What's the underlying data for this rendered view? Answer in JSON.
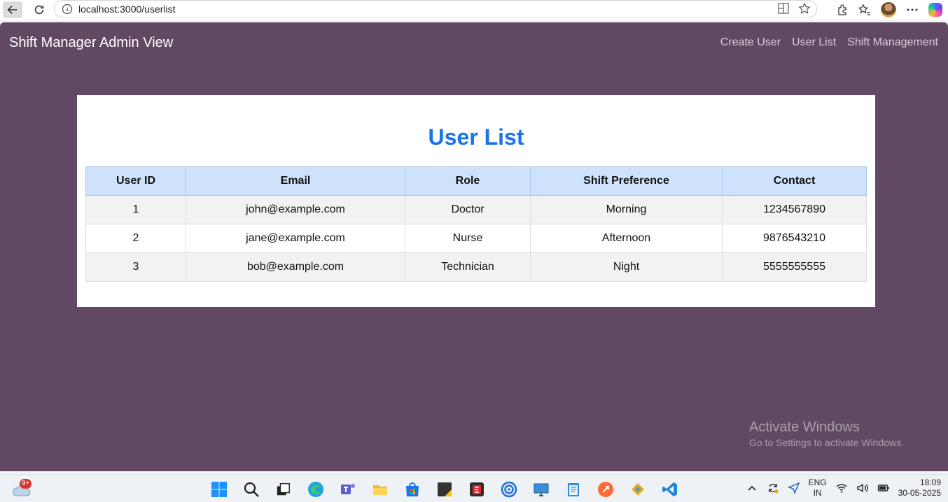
{
  "browser": {
    "url": "localhost:3000/userlist"
  },
  "app": {
    "title": "Shift Manager Admin View",
    "nav": [
      "Create User",
      "User List",
      "Shift Management"
    ]
  },
  "userlist": {
    "title": "User List",
    "columns": [
      "User ID",
      "Email",
      "Role",
      "Shift Preference",
      "Contact"
    ],
    "rows": [
      [
        "1",
        "john@example.com",
        "Doctor",
        "Morning",
        "1234567890"
      ],
      [
        "2",
        "jane@example.com",
        "Nurse",
        "Afternoon",
        "9876543210"
      ],
      [
        "3",
        "bob@example.com",
        "Technician",
        "Night",
        "5555555555"
      ]
    ]
  },
  "watermark": {
    "title": "Activate Windows",
    "subtitle": "Go to Settings to activate Windows."
  },
  "taskbar": {
    "weather_badge": "9+",
    "language": "ENG",
    "region": "IN",
    "time": "18:09",
    "date": "30-05-2025"
  },
  "colors": {
    "page_bg": "#614964",
    "title_blue": "#1a73e8",
    "header_row": "#cfe2fb"
  }
}
